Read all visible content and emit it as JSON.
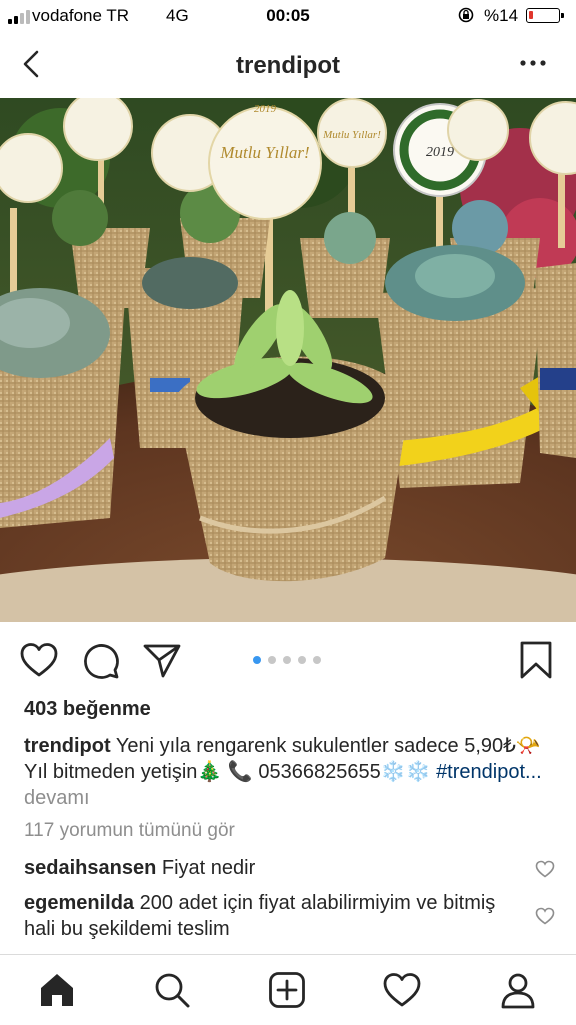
{
  "status_bar": {
    "carrier": "vodafone TR",
    "network": "4G",
    "time": "00:05",
    "battery": "%14",
    "battery_level": 0.14
  },
  "header": {
    "title": "trendipot"
  },
  "photo": {
    "tag_texts": [
      "2019",
      "Mutlu Yıllar!",
      "Mutlu Yıllar!",
      "2019"
    ],
    "colors": {
      "burlap": "#c4a676",
      "ribbon_purple": "#c9a6e6",
      "ribbon_yellow": "#f2d21b",
      "ribbon_blue": "#3b6fc4",
      "table": "#6b3e25"
    }
  },
  "carousel": {
    "count": 5,
    "active": 1
  },
  "post": {
    "likes": "403 beğenme",
    "author": "trendipot",
    "caption_text": "Yeni yıla rengarenk sukulentler sadece 5,90₺📯 Yıl bitmeden yetişin🎄 📞 05366825655❄️❄️",
    "hashtag": "#trendipot...",
    "more": "devamı",
    "view_comments": "117 yorumun tümünü gör"
  },
  "comments": [
    {
      "user": "sedaihsansen",
      "text": "Fiyat nedir"
    },
    {
      "user": "egemenilda",
      "text": "200 adet için fiyat alabilirmiyim ve bitmiş hali bu şekildemi teslim"
    }
  ],
  "colors": {
    "link_blue": "#003569",
    "active_dot": "#3897f0",
    "muted": "#8e8e8e"
  }
}
